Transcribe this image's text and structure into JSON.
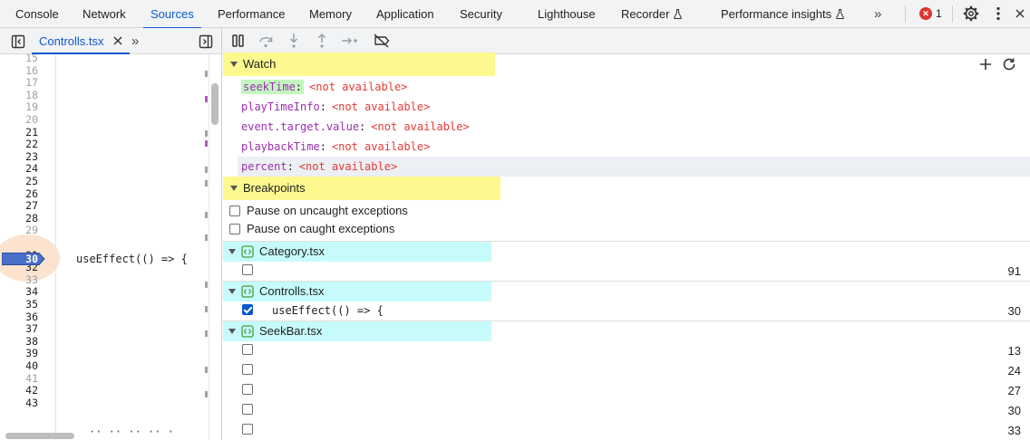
{
  "tabs": [
    {
      "label": "Console",
      "active": false
    },
    {
      "label": "Network",
      "active": false
    },
    {
      "label": "Sources",
      "active": true
    },
    {
      "label": "Performance",
      "active": false
    },
    {
      "label": "Memory",
      "active": false
    },
    {
      "label": "Application",
      "active": false
    },
    {
      "label": "Security",
      "active": false
    },
    {
      "label": "Lighthouse",
      "active": false
    },
    {
      "label": "Recorder",
      "active": false,
      "experimental": true
    },
    {
      "label": "Performance insights",
      "active": false,
      "experimental": true
    }
  ],
  "more_tabs_glyph": "»",
  "error_count": "1",
  "editor": {
    "file_tab": "Controlls.tsx",
    "more_glyph": "»",
    "line_numbers": [
      "15",
      "16",
      "17",
      "18",
      "19",
      "20",
      "21",
      "22",
      "23",
      "24",
      "25",
      "26",
      "27",
      "28",
      "29",
      "30",
      "31",
      "32",
      "33",
      "34",
      "35",
      "36",
      "37",
      "38",
      "39",
      "40",
      "41",
      "42",
      "43"
    ],
    "dim_lines": [
      "15",
      "16",
      "17",
      "18",
      "19",
      "20",
      "29",
      "33",
      "41"
    ],
    "breakpoint_line": "30",
    "code_line": "useEffect(() => {"
  },
  "watch": {
    "title": "Watch",
    "items": [
      {
        "expr": "seekTime",
        "value": "<not available>"
      },
      {
        "expr": "playTimeInfo",
        "value": "<not available>"
      },
      {
        "expr": "event.target.value",
        "value": "<not available>"
      },
      {
        "expr": "playbackTime",
        "value": "<not available>"
      },
      {
        "expr": "percent",
        "value": "<not available>"
      }
    ]
  },
  "breakpoints": {
    "title": "Breakpoints",
    "pause_uncaught": {
      "label": "Pause on uncaught exceptions",
      "checked": false
    },
    "pause_caught": {
      "label": "Pause on caught exceptions",
      "checked": false
    },
    "groups": [
      {
        "file": "Category.tsx",
        "items": [
          {
            "code": "",
            "line": "91",
            "checked": false
          }
        ]
      },
      {
        "file": "Controlls.tsx",
        "items": [
          {
            "code": "useEffect(() => {",
            "line": "30",
            "checked": true
          }
        ]
      },
      {
        "file": "SeekBar.tsx",
        "items": [
          {
            "code": "",
            "line": "13",
            "checked": false
          },
          {
            "code": "",
            "line": "24",
            "checked": false
          },
          {
            "code": "",
            "line": "27",
            "checked": false
          },
          {
            "code": "",
            "line": "30",
            "checked": false
          },
          {
            "code": "",
            "line": "33",
            "checked": false
          }
        ]
      }
    ]
  },
  "colors": {
    "accent": "#0b57d0",
    "section_highlight": "#fdf98f",
    "file_highlight": "#c7fbfb",
    "watch_expr": "#9b30b0",
    "watch_value": "#e53935",
    "error": "#dc362e"
  },
  "icons": {
    "toolbar": [
      "pause-icon",
      "step-over-icon",
      "step-into-icon",
      "step-out-icon",
      "step-icon",
      "deactivate-breakpoints-icon"
    ],
    "watch_actions": [
      "add-icon",
      "refresh-icon"
    ],
    "top_right": [
      "error-icon",
      "gear-icon",
      "kebab-icon",
      "close-icon"
    ]
  }
}
